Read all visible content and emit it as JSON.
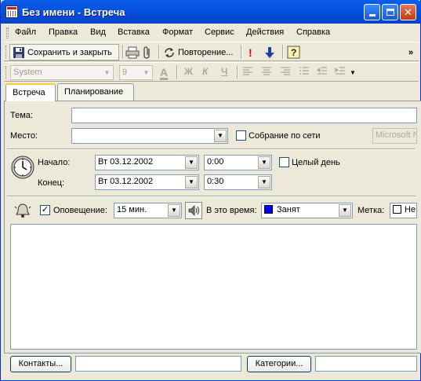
{
  "window": {
    "title": "Без имени - Встреча"
  },
  "menu": [
    "Файл",
    "Правка",
    "Вид",
    "Вставка",
    "Формат",
    "Сервис",
    "Действия",
    "Справка"
  ],
  "toolbar": {
    "save_close": "Сохранить и закрыть",
    "recurrence": "Повторение...",
    "overflow": "»"
  },
  "format_toolbar": {
    "font": "System",
    "size": "9"
  },
  "tabs": [
    "Встреча",
    "Планирование"
  ],
  "form": {
    "subject_label": "Тема:",
    "subject_value": "",
    "location_label": "Место:",
    "location_value": "",
    "online_meeting_label": "Собрание по сети",
    "online_meeting_checked": false,
    "netmeeting_value": "Microsoft N",
    "start_label": "Начало:",
    "start_date": "Вт 03.12.2002",
    "start_time": "0:00",
    "allday_label": "Целый день",
    "allday_checked": false,
    "end_label": "Конец:",
    "end_date": "Вт 03.12.2002",
    "end_time": "0:30",
    "reminder_label": "Оповещение:",
    "reminder_checked": true,
    "reminder_value": "15 мин.",
    "showas_label": "В это время:",
    "showas_value": "Занят",
    "showas_color": "#0000FF",
    "label_label": "Метка:",
    "label_value": "Не"
  },
  "bottom": {
    "contacts_button": "Контакты...",
    "contacts_value": "",
    "categories_button": "Категории...",
    "categories_value": ""
  }
}
